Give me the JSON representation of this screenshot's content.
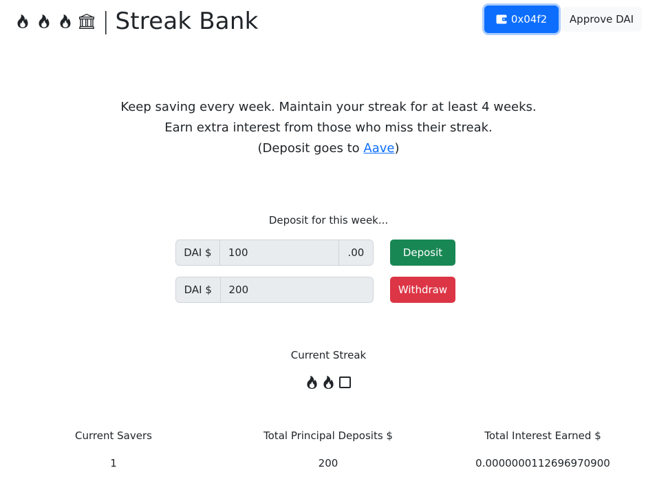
{
  "header": {
    "icons": [
      "fire-icon",
      "fire-icon",
      "fire-icon",
      "bank-icon"
    ],
    "separator": "|",
    "title": "Streak Bank",
    "wallet_label": "0x04f2",
    "approve_label": "Approve DAI"
  },
  "intro": {
    "line1": "Keep saving every week. Maintain your streak for at least 4 weeks.",
    "line2": "Earn extra interest from those who miss their streak.",
    "line3_prefix": "(Deposit goes to ",
    "line3_link": "Aave",
    "line3_suffix": ")"
  },
  "deposit": {
    "label": "Deposit for this week...",
    "prefix": "DAI $",
    "value": "100",
    "suffix": ".00",
    "button": "Deposit"
  },
  "withdraw": {
    "prefix": "DAI $",
    "value": "200",
    "button": "Withdraw"
  },
  "streak": {
    "label": "Current Streak",
    "icons": [
      "fire-icon",
      "fire-icon",
      "empty-box-icon"
    ]
  },
  "stats": {
    "savers_label": "Current Savers",
    "savers_value": "1",
    "principal_label": "Total Principal Deposits $",
    "principal_value": "200",
    "interest_label": "Total Interest Earned $",
    "interest_value": "0.0000000112696970900"
  },
  "colors": {
    "primary": "#0d6efd",
    "success": "#198754",
    "danger": "#dc3545",
    "text": "#212529"
  }
}
